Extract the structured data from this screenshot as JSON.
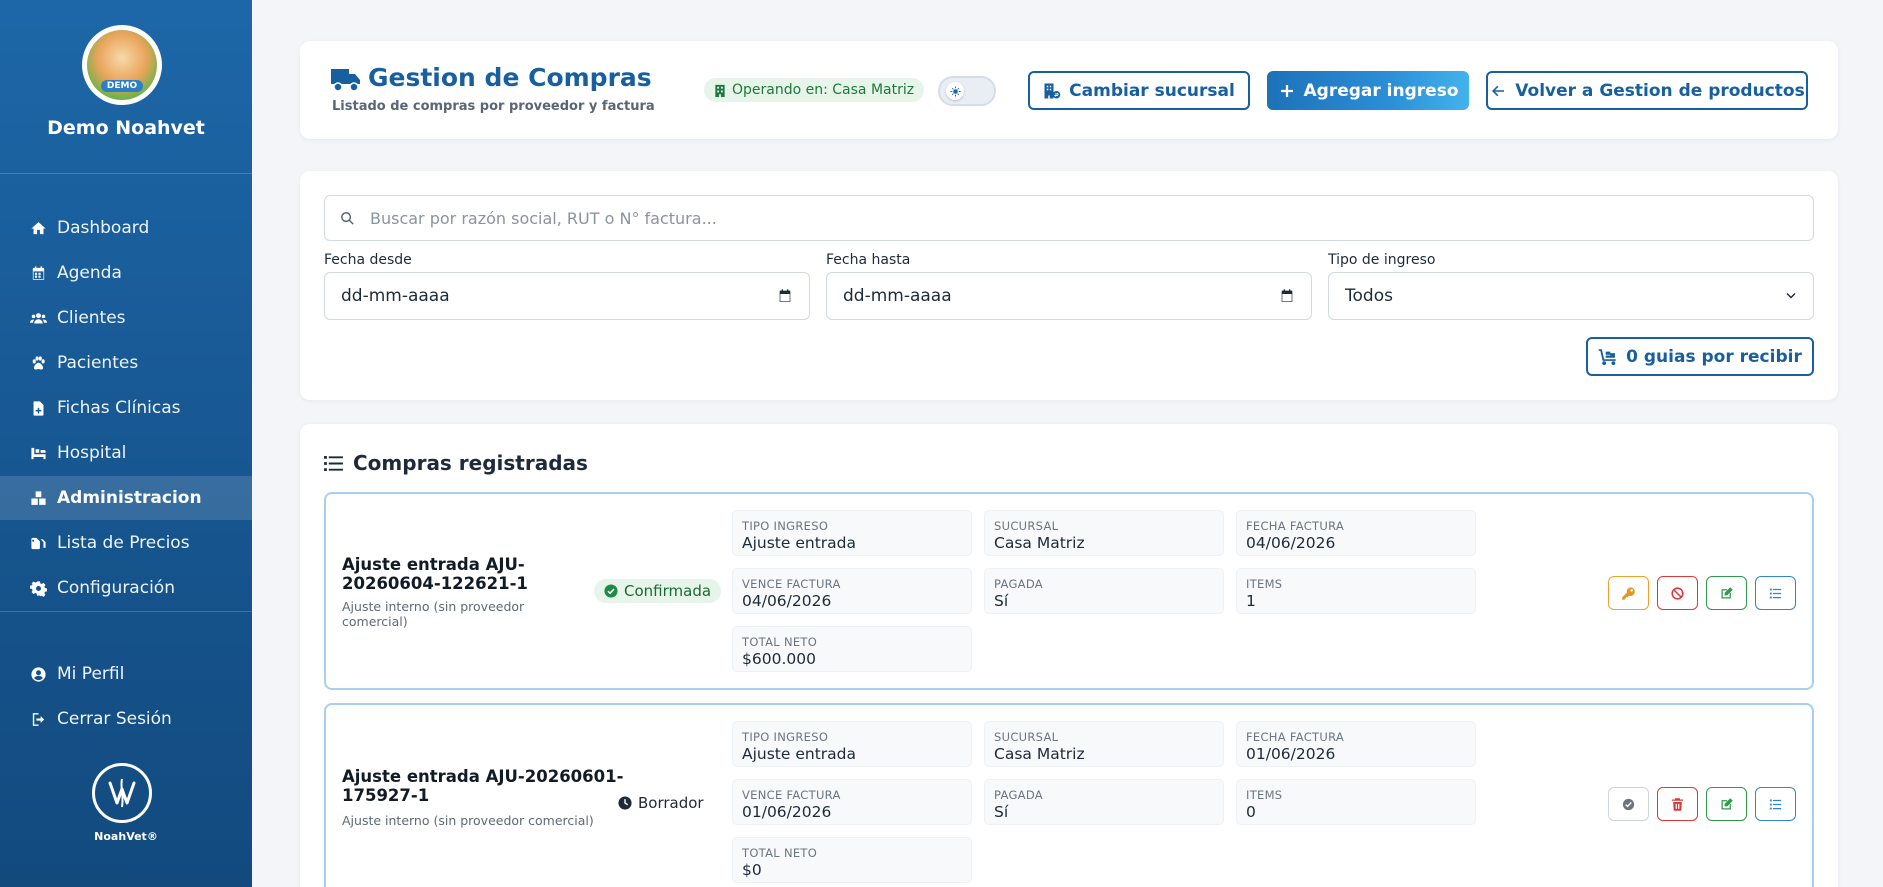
{
  "sidebar": {
    "logo_badge": "DEMO",
    "clinic_name": "Demo Noahvet",
    "items": [
      {
        "label": "Dashboard",
        "icon": "home-icon"
      },
      {
        "label": "Agenda",
        "icon": "calendar-icon"
      },
      {
        "label": "Clientes",
        "icon": "users-icon"
      },
      {
        "label": "Pacientes",
        "icon": "paw-icon"
      },
      {
        "label": "Fichas Clínicas",
        "icon": "medical-file-icon"
      },
      {
        "label": "Hospital",
        "icon": "hospital-bed-icon"
      },
      {
        "label": "Administracion",
        "icon": "boxes-icon",
        "active": true
      },
      {
        "label": "Lista de Precios",
        "icon": "price-tag-icon"
      },
      {
        "label": "Configuración",
        "icon": "gear-icon"
      }
    ],
    "bottom_items": [
      {
        "label": "Mi Perfil",
        "icon": "user-circle-icon"
      },
      {
        "label": "Cerrar Sesión",
        "icon": "logout-icon"
      }
    ],
    "brand_name": "NoahVet®"
  },
  "header": {
    "title": "Gestion de Compras",
    "subtitle": "Listado de compras por proveedor y factura",
    "branch_badge": "Operando en: Casa Matriz",
    "change_branch_label": "Cambiar sucursal",
    "add_entry_label": "Agregar ingreso",
    "back_label": "Volver a Gestion de productos"
  },
  "filters": {
    "search_placeholder": "Buscar por razón social, RUT o N° factura...",
    "date_from_label": "Fecha desde",
    "date_from_value": "dd-mm-aaaa",
    "date_to_label": "Fecha hasta",
    "date_to_value": "dd-mm-aaaa",
    "type_label": "Tipo de ingreso",
    "type_value": "Todos",
    "guides_button": "0 guias por recibir"
  },
  "list": {
    "title": "Compras registradas",
    "field_labels": {
      "tipo": "TIPO INGRESO",
      "sucursal": "SUCURSAL",
      "fecha": "FECHA FACTURA",
      "vence": "VENCE FACTURA",
      "pagada": "PAGADA",
      "items": "ITEMS",
      "neto": "TOTAL NETO"
    },
    "purchases": [
      {
        "title_line1": "Ajuste entrada AJU-",
        "title_line2": "20260604-122621-1",
        "subtitle_line1": "Ajuste interno (sin proveedor",
        "subtitle_line2": "comercial)",
        "status": "Confirmada",
        "tipo": "Ajuste entrada",
        "sucursal": "Casa Matriz",
        "fecha": "04/06/2026",
        "vence": "04/06/2026",
        "pagada": "Sí",
        "items": "1",
        "neto": "$600.000"
      },
      {
        "title_line1": "Ajuste entrada AJU-20260601-",
        "title_line2": "175927-1",
        "subtitle_line1": "Ajuste interno (sin proveedor comercial)",
        "subtitle_line2": "",
        "status": "Borrador",
        "tipo": "Ajuste entrada",
        "sucursal": "Casa Matriz",
        "fecha": "01/06/2026",
        "vence": "01/06/2026",
        "pagada": "Sí",
        "items": "0",
        "neto": "$0"
      }
    ]
  },
  "colors": {
    "sidebar": "#1d67a8",
    "primary": "#175f9f",
    "success": "#1b6a34",
    "danger": "#dc3a3a",
    "warning": "#f0a12c"
  }
}
